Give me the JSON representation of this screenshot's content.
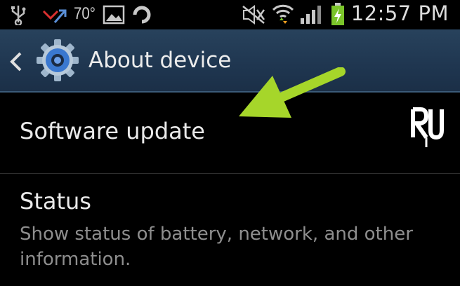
{
  "status_bar": {
    "temperature": "70°",
    "time": "12:57 PM",
    "icons": [
      "usb-icon",
      "missed-call-icon",
      "gallery-icon",
      "sync-icon",
      "mute-icon",
      "wifi-icon",
      "signal-icon",
      "battery-charging-icon"
    ],
    "colors": {
      "battery": "#7bc52a",
      "wifi_up": "#f0a020",
      "missed_call": "#d93030"
    }
  },
  "action_bar": {
    "title": "About device",
    "back_icon": "back-chevron-icon",
    "app_icon": "settings-gear-icon",
    "colors": {
      "background": "#203852",
      "gear": "#3a78d0"
    }
  },
  "list": {
    "software_update": {
      "title": "Software update"
    },
    "status": {
      "title": "Status",
      "subtitle": "Show status of battery, network, and other information."
    }
  },
  "annotation": {
    "arrow_color": "#a6d62a",
    "arrow_icon": "pointer-arrow-icon",
    "watermark": "RU"
  }
}
